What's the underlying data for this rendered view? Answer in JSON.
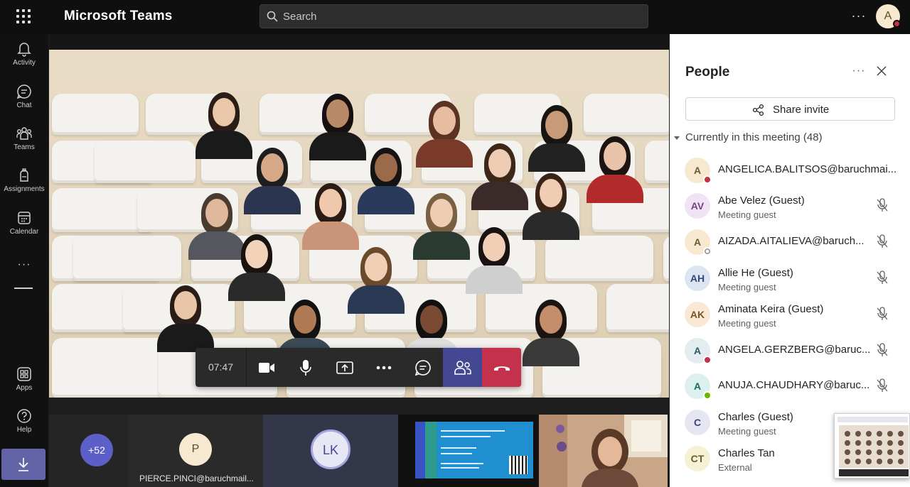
{
  "app": {
    "title": "Microsoft Teams"
  },
  "search": {
    "placeholder": "Search"
  },
  "user": {
    "initial": "A",
    "status_color": "#c4314b"
  },
  "rail": {
    "items": [
      {
        "label": "Activity",
        "icon": "bell-icon"
      },
      {
        "label": "Chat",
        "icon": "chat-icon"
      },
      {
        "label": "Teams",
        "icon": "teams-icon"
      },
      {
        "label": "Assignments",
        "icon": "assignments-icon"
      },
      {
        "label": "Calendar",
        "icon": "calendar-icon"
      },
      {
        "label": "Apps",
        "icon": "apps-icon"
      },
      {
        "label": "Help",
        "icon": "help-icon"
      }
    ],
    "more": "···",
    "download_icon": "download-icon"
  },
  "meeting": {
    "timer": "07:47",
    "controls": [
      "camera-icon",
      "mic-icon",
      "share-screen-icon",
      "more-icon",
      "chat-icon",
      "participants-icon",
      "hang-up-icon"
    ],
    "hangup_color": "#c4314b",
    "participants_active_color": "#444791"
  },
  "strip": {
    "overflow_count": "+52",
    "tile_p": {
      "initial": "P",
      "name": "PIERCE.PINCI@baruchmail..."
    },
    "tile_lk": {
      "initials": "LK"
    }
  },
  "people_panel": {
    "title": "People",
    "share_label": "Share invite",
    "section_label": "Currently in this meeting",
    "section_count": "(48)",
    "participants": [
      {
        "initials": "A",
        "name": "ANGELICA.BALITSOS@baruchmai...",
        "subtitle": "",
        "avatar_bg": "#f6e9cf",
        "avatar_fg": "#6b5a33",
        "status": "busy",
        "muted": false
      },
      {
        "initials": "AV",
        "name": "Abe Velez (Guest)",
        "subtitle": "Meeting guest",
        "avatar_bg": "#f0e3f4",
        "avatar_fg": "#7a3f88",
        "status": "",
        "muted": true
      },
      {
        "initials": "A",
        "name": "AIZADA.AITALIEVA@baruch...",
        "subtitle": "",
        "avatar_bg": "#f6e9cf",
        "avatar_fg": "#6b5a33",
        "status": "away",
        "muted": true
      },
      {
        "initials": "AH",
        "name": "Allie He (Guest)",
        "subtitle": "Meeting guest",
        "avatar_bg": "#dde5f3",
        "avatar_fg": "#2e4a7a",
        "status": "",
        "muted": true
      },
      {
        "initials": "AK",
        "name": "Aminata Keira (Guest)",
        "subtitle": "Meeting guest",
        "avatar_bg": "#f9e8d5",
        "avatar_fg": "#7a5327",
        "status": "",
        "muted": true
      },
      {
        "initials": "A",
        "name": "ANGELA.GERZBERG@baruc...",
        "subtitle": "",
        "avatar_bg": "#e3ecef",
        "avatar_fg": "#2d5a66",
        "status": "busy",
        "muted": true
      },
      {
        "initials": "A",
        "name": "ANUJA.CHAUDHARY@baruc...",
        "subtitle": "",
        "avatar_bg": "#dcf0ee",
        "avatar_fg": "#1e6b61",
        "status": "available",
        "muted": true
      },
      {
        "initials": "C",
        "name": "Charles (Guest)",
        "subtitle": "Meeting guest",
        "avatar_bg": "#e6e6f3",
        "avatar_fg": "#3d3f7a",
        "status": "",
        "muted": false
      },
      {
        "initials": "CT",
        "name": "Charles Tan",
        "subtitle": "External",
        "avatar_bg": "#f6f0d5",
        "avatar_fg": "#6b5e27",
        "status": "",
        "muted": false
      }
    ]
  }
}
